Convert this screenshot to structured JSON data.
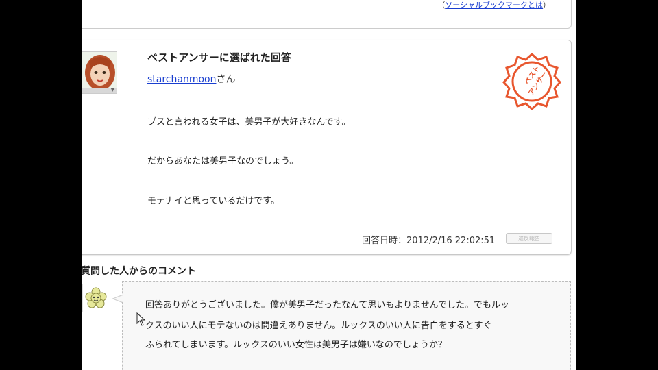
{
  "social": {
    "prefix": "（",
    "link_text": "ソーシャルブックマークとは",
    "suffix": "）"
  },
  "best_answer": {
    "title": "ベストアンサーに選ばれた回答",
    "user": "starchanmoon",
    "user_suffix": "さん",
    "lines": [
      "ブスと言われる女子は、美男子が大好きなんです。",
      "だからあなたは美男子なのでしょう。",
      "モテナイと思っているだけです。"
    ],
    "answer_date": "回答日時：2012/2/16 22:02:51",
    "report_label": "違反報告",
    "stamp_icon": "best-answer-stamp-icon",
    "stamp_text": "ベスト アンサー"
  },
  "comment": {
    "heading": "質問した人からのコメント",
    "lines": [
      "回答ありがとうございました。僕が美男子だったなんて思いもよりませんでした。でもルッ",
      "クスのいい人にモテないのは間違えありません。ルックスのいい人に告白をするとすぐ",
      "ふられてしまいます。ルックスのいい女性は美男子は嫌いなのでしょうか？"
    ]
  },
  "colors": {
    "link": "#1a3fd0",
    "stamp": "#e8562e",
    "border": "#c8c8c8"
  }
}
